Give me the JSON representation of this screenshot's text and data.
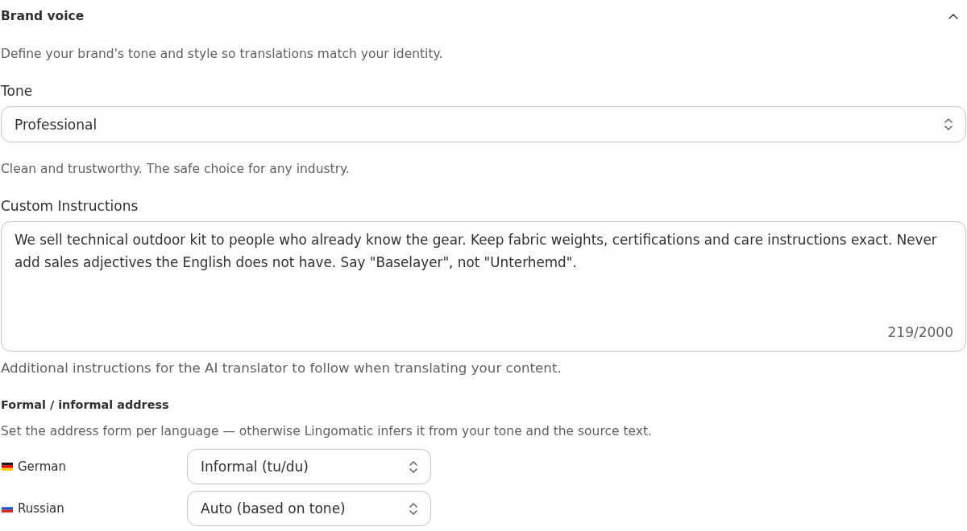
{
  "section": {
    "title": "Brand voice",
    "expanded": true,
    "description": "Define your brand's tone and style so translations match your identity."
  },
  "tone": {
    "label": "Tone",
    "value": "Professional",
    "hint": "Clean and trustworthy. The safe choice for any industry."
  },
  "custom_instructions": {
    "label": "Custom Instructions",
    "value": "We sell technical outdoor kit to people who already know the gear. Keep fabric weights, certifications and care instructions exact. Never add sales adjectives the English does not have. Say \"Baselayer\", not \"Unterhemd\".",
    "counter": "219/2000",
    "hint": "Additional instructions for the AI translator to follow when translating your content."
  },
  "address_form": {
    "title": "Formal / informal address",
    "description": "Set the address form per language — otherwise Lingomatic infers it from your tone and the source text.",
    "languages": [
      {
        "kind": "de",
        "name": "German",
        "value": "Informal (tu/du)"
      },
      {
        "kind": "ru",
        "name": "Russian",
        "value": "Auto (based on tone)"
      }
    ]
  }
}
